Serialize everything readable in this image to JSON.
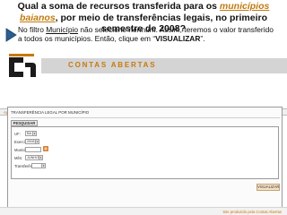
{
  "question": {
    "part1": "Qual a soma de recursos transferida para os ",
    "highlight": "municípios baianos",
    "part2": ", por meio de transferências legais, no primeiro semestre de 2008?"
  },
  "instruction": {
    "part1": "No filtro ",
    "underlined": "Município",
    "part2": " não selecione nenhum. Assim, teremos o valor transferido a todos os municípios. Então, clique em “",
    "bold": "VISUALIZAR",
    "part3": "”."
  },
  "colors": {
    "brand": "#c8780e",
    "highlight": "#c07a10",
    "band": "#d4d4d4"
  },
  "icons": {
    "pointer": "arrow-pointer-icon",
    "logo": "cn-logo-icon",
    "picker": "picker-icon",
    "dropdown": "chevron-down-icon"
  },
  "app": {
    "brand_title": "CONTAS ABERTAS"
  },
  "nav": {
    "items": [
      "Apresentação",
      "Transferências da Bahia",
      "Fale mais tarde"
    ]
  },
  "form": {
    "title": "TRANSFERÊNCIA LEGAL POR MUNICÍPIO",
    "filter_tab": "PESQUISAR POR",
    "fields": [
      {
        "label": "UF:",
        "value": "BA"
      },
      {
        "label": "Exercício:",
        "value": "2008"
      },
      {
        "label": "Município:",
        "value": ""
      },
      {
        "label": "Mês:",
        "value": "JUNHO"
      },
      {
        "label": "Transferência:",
        "value": ""
      }
    ],
    "submit_label": "VISUALIZAR"
  },
  "footer": {
    "text": "Site produzido pela Contas Abertas"
  }
}
